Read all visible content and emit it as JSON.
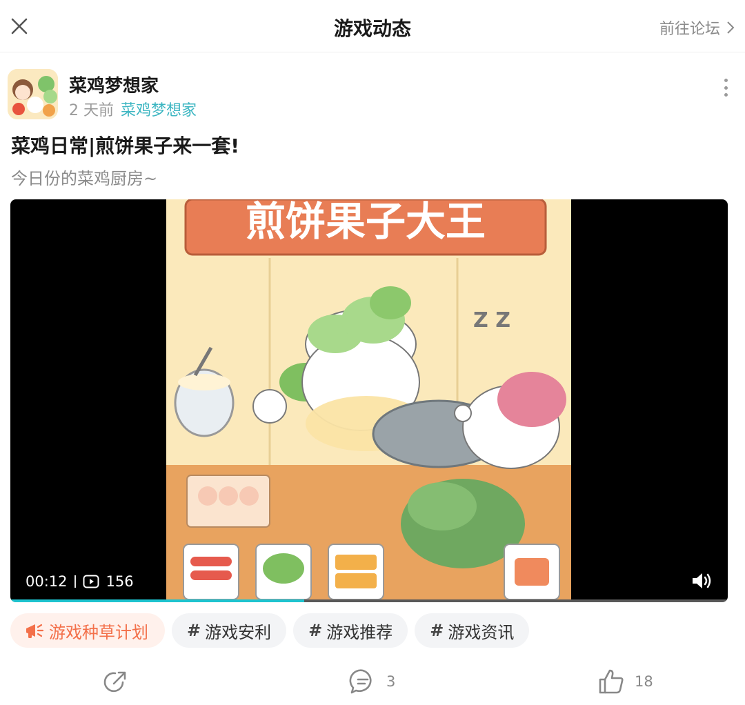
{
  "header": {
    "title": "游戏动态",
    "forum_link": "前往论坛"
  },
  "post": {
    "author_name": "菜鸡梦想家",
    "time_ago": "2 天前",
    "game_name": "菜鸡梦想家",
    "title": "菜鸡日常|煎饼果子来一套!",
    "subtitle": "今日份的菜鸡厨房~",
    "video": {
      "current_time": "00:12",
      "play_count": "156",
      "progress": 0.41,
      "frame_banner_text": "煎饼果子大王",
      "frame_snore_text": "Z Z"
    },
    "tags": [
      {
        "label": "游戏种草计划",
        "icon": "megaphone-icon"
      },
      {
        "label": "游戏安利",
        "icon": "hash-icon"
      },
      {
        "label": "游戏推荐",
        "icon": "hash-icon"
      },
      {
        "label": "游戏资讯",
        "icon": "hash-icon"
      }
    ],
    "actions": {
      "share_count": "",
      "comment_count": "3",
      "like_count": "18"
    }
  },
  "colors": {
    "accent": "#3db6c2",
    "progress": "#1ec3cf",
    "hot_tag_text": "#f3704a",
    "hot_tag_bg": "#fff1ec"
  }
}
